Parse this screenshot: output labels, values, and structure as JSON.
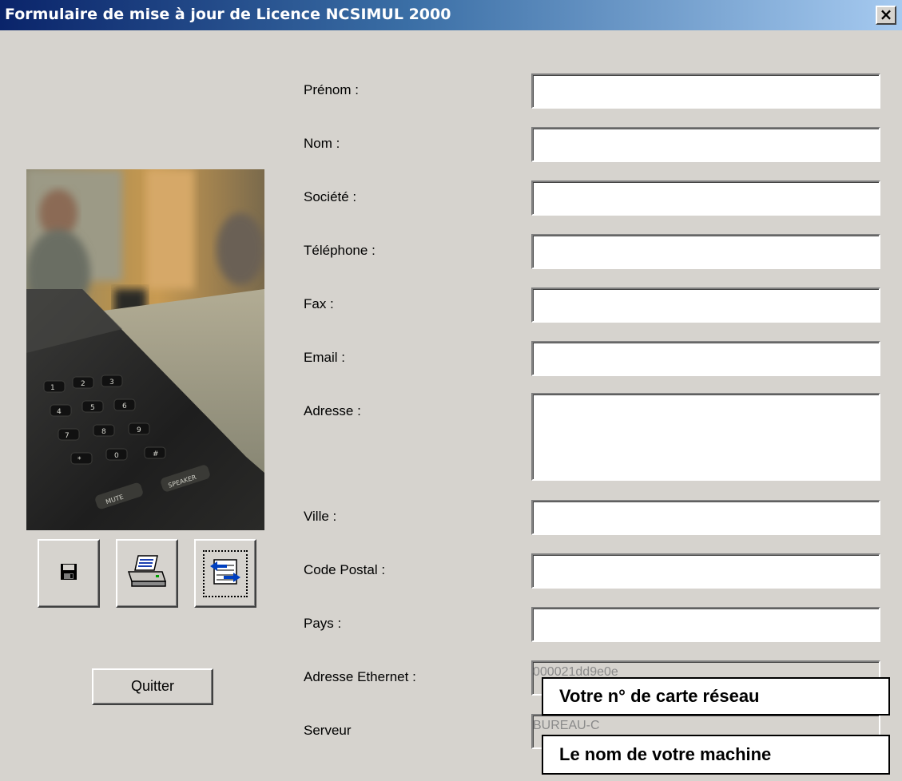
{
  "window": {
    "title": "Formulaire de mise à jour de Licence NCSIMUL 2000",
    "close_label": "×"
  },
  "form": {
    "fields": [
      {
        "label": "Prénom :",
        "value": ""
      },
      {
        "label": "Nom :",
        "value": ""
      },
      {
        "label": "Société :",
        "value": ""
      },
      {
        "label": "Téléphone :",
        "value": ""
      },
      {
        "label": "Fax :",
        "value": ""
      },
      {
        "label": "Email :",
        "value": ""
      },
      {
        "label": "Adresse :",
        "value": ""
      },
      {
        "label": "Ville :",
        "value": ""
      },
      {
        "label": "Code Postal :",
        "value": ""
      },
      {
        "label": "Pays :",
        "value": ""
      },
      {
        "label": "Adresse Ethernet :",
        "value": "000021dd9e0e"
      },
      {
        "label": "Serveur",
        "value": "BUREAU-C"
      }
    ]
  },
  "toolbar": {
    "save_icon": "floppy-disk-icon",
    "print_icon": "printer-icon",
    "send_icon": "transfer-icon"
  },
  "quit_label": "Quitter",
  "callouts": {
    "ethernet": "Votre n° de carte réseau",
    "server": "Le nom de votre machine"
  }
}
